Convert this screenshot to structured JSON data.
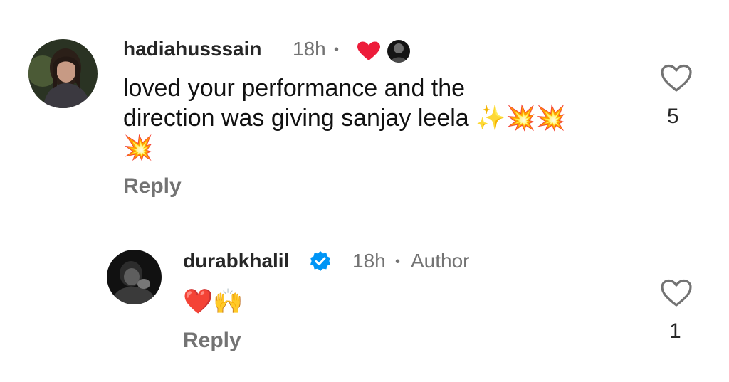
{
  "comments": [
    {
      "username": "hadiahusssain",
      "time": "18h",
      "separator": "•",
      "text_line1": "loved your performance and the",
      "text_line2": "direction was giving sanjay leela ✨💥💥",
      "text_line3": "💥",
      "reply_label": "Reply",
      "like_count": "5",
      "liked_by_author_icon": "red-heart-icon",
      "colors": {
        "heart": "#ED1C3A"
      }
    },
    {
      "username": "durabkhalil",
      "time": "18h",
      "separator": "•",
      "author_label": "Author",
      "text": "❤️🙌",
      "reply_label": "Reply",
      "like_count": "1",
      "verified_color": "#0095F6"
    }
  ]
}
